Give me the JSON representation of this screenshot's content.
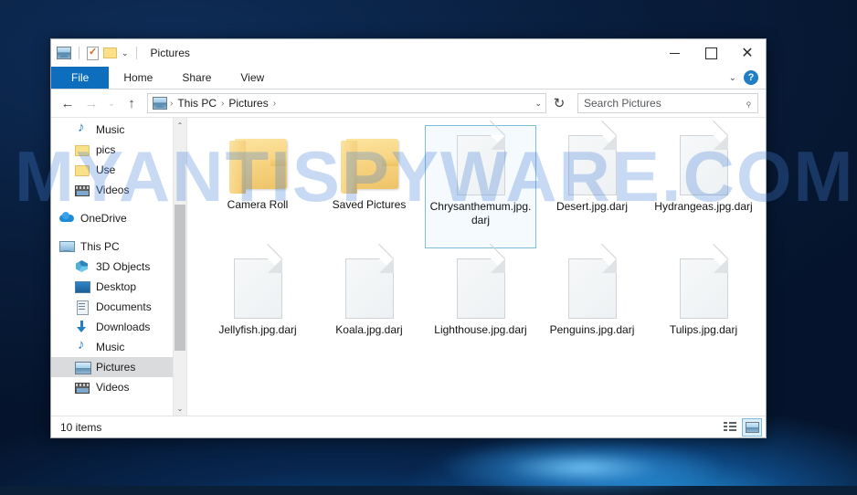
{
  "desktop": {
    "watermark": "MYANTISPYWARE.COM"
  },
  "window": {
    "title": "Pictures",
    "quick_access": [
      "pictures-icon",
      "properties-icon",
      "new-folder-icon",
      "customize-caret"
    ],
    "controls": {
      "minimize": "—",
      "maximize": "□",
      "close": "✕",
      "ribbon_chevron": "⌄",
      "help": "?"
    }
  },
  "ribbon": {
    "tabs": [
      {
        "label": "File",
        "active": true
      },
      {
        "label": "Home",
        "active": false
      },
      {
        "label": "Share",
        "active": false
      },
      {
        "label": "View",
        "active": false
      }
    ]
  },
  "address": {
    "back": "←",
    "forward": "→",
    "recent": "⌄",
    "up": "↑",
    "crumbs": [
      "This PC",
      "Pictures"
    ],
    "separator": "›",
    "dropdown_caret": "⌄",
    "refresh": "↻"
  },
  "search": {
    "placeholder": "Search Pictures",
    "icon": "search-icon"
  },
  "sidebar": {
    "items": [
      {
        "label": "Music",
        "icon": "music-icon",
        "indent": 1,
        "selected": false,
        "gap_before": false
      },
      {
        "label": "pics",
        "icon": "folder-icon",
        "indent": 1,
        "selected": false,
        "gap_before": false
      },
      {
        "label": "Use",
        "icon": "folder-icon",
        "indent": 1,
        "selected": false,
        "gap_before": false
      },
      {
        "label": "Videos",
        "icon": "video-icon",
        "indent": 1,
        "selected": false,
        "gap_before": false
      },
      {
        "label": "OneDrive",
        "icon": "onedrive-icon",
        "indent": 0,
        "selected": false,
        "gap_before": true
      },
      {
        "label": "This PC",
        "icon": "computer-icon",
        "indent": 0,
        "selected": false,
        "gap_before": true
      },
      {
        "label": "3D Objects",
        "icon": "cube-icon",
        "indent": 1,
        "selected": false,
        "gap_before": false
      },
      {
        "label": "Desktop",
        "icon": "desktop-icon",
        "indent": 1,
        "selected": false,
        "gap_before": false
      },
      {
        "label": "Documents",
        "icon": "document-icon",
        "indent": 1,
        "selected": false,
        "gap_before": false
      },
      {
        "label": "Downloads",
        "icon": "download-icon",
        "indent": 1,
        "selected": false,
        "gap_before": false
      },
      {
        "label": "Music",
        "icon": "music-icon",
        "indent": 1,
        "selected": false,
        "gap_before": false
      },
      {
        "label": "Pictures",
        "icon": "pictures-icon",
        "indent": 1,
        "selected": true,
        "gap_before": false
      },
      {
        "label": "Videos",
        "icon": "video-icon",
        "indent": 1,
        "selected": false,
        "gap_before": false
      }
    ]
  },
  "files": [
    {
      "name": "Camera Roll",
      "type": "folder",
      "selected": false
    },
    {
      "name": "Saved Pictures",
      "type": "folder",
      "selected": false
    },
    {
      "name": "Chrysanthemum.jpg.darj",
      "type": "file",
      "selected": true
    },
    {
      "name": "Desert.jpg.darj",
      "type": "file",
      "selected": false
    },
    {
      "name": "Hydrangeas.jpg.darj",
      "type": "file",
      "selected": false
    },
    {
      "name": "Jellyfish.jpg.darj",
      "type": "file",
      "selected": false
    },
    {
      "name": "Koala.jpg.darj",
      "type": "file",
      "selected": false
    },
    {
      "name": "Lighthouse.jpg.darj",
      "type": "file",
      "selected": false
    },
    {
      "name": "Penguins.jpg.darj",
      "type": "file",
      "selected": false
    },
    {
      "name": "Tulips.jpg.darj",
      "type": "file",
      "selected": false
    }
  ],
  "status": {
    "item_count": "10 items",
    "views": [
      {
        "name": "details-view",
        "active": false
      },
      {
        "name": "large-icons-view",
        "active": true
      }
    ]
  },
  "colors": {
    "accent": "#0d6ebe",
    "selection_border": "#7fbcd9",
    "folder": "#f5d07c",
    "desktop": "#0a2244"
  }
}
